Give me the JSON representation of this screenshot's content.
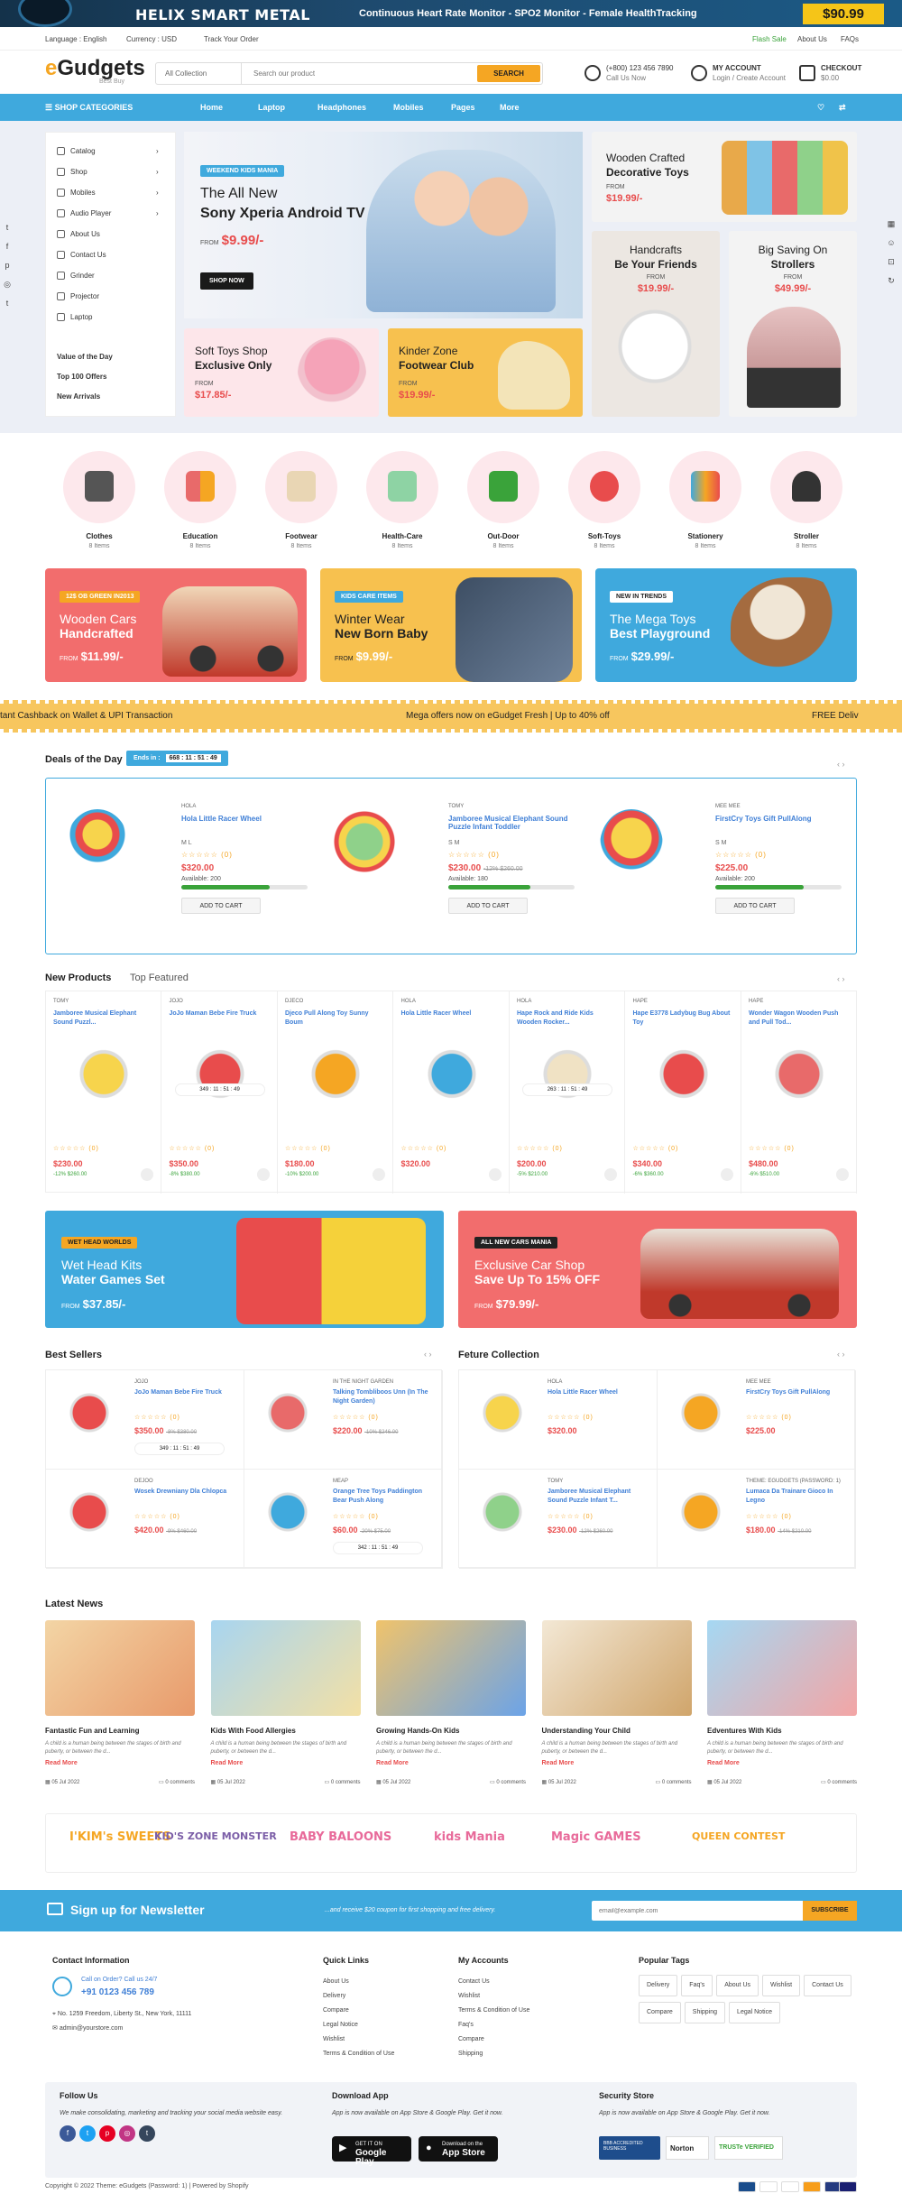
{
  "topbanner": {
    "brand": "HELIX SMART METAL",
    "promo": "Continuous Heart Rate Monitor - SPO2 Monitor - Female HealthTracking",
    "price": "$90.99"
  },
  "util": {
    "language": "Language : English",
    "currency": "Currency : USD",
    "track": "Track Your Order",
    "flash": "Flash Sale",
    "about": "About Us",
    "faqs": "FAQs"
  },
  "header": {
    "logo_e": "e",
    "logo_rest": "Gudgets",
    "logo_sub": "Best Buy",
    "search_cat": "All Collection",
    "search_placeholder": "Search our product",
    "search_btn": "SEARCH",
    "phone": "(+800) 123 456 7890",
    "phone_sub": "Call Us Now",
    "account": "MY ACCOUNT",
    "account_sub": "Login / Create Account",
    "checkout": "CHECKOUT",
    "checkout_sub": "$0.00"
  },
  "nav": {
    "categories": "SHOP CATEGORIES",
    "items": [
      "Home",
      "Laptop",
      "Headphones",
      "Mobiles",
      "Pages",
      "More"
    ]
  },
  "sidebar": {
    "items": [
      "Catalog",
      "Shop",
      "Mobiles",
      "Audio Player",
      "About Us",
      "Contact Us",
      "Grinder",
      "Projector",
      "Laptop"
    ],
    "links": [
      "Value of the Day",
      "Top 100 Offers",
      "New Arrivals"
    ]
  },
  "hero": {
    "tag": "WEEKEND KIDS MANIA",
    "t1": "The All New",
    "t2": "Sony Xperia Android TV",
    "from": "FROM",
    "price": "$9.99/-",
    "btn": "SHOP NOW"
  },
  "promo_small": [
    {
      "t1": "Soft Toys Shop",
      "t2": "Exclusive Only",
      "from": "FROM",
      "price": "$17.85/-"
    },
    {
      "t1": "Kinder Zone",
      "t2": "Footwear Club",
      "from": "FROM",
      "price": "$19.99/-"
    }
  ],
  "promo_right": [
    {
      "t1": "Wooden Crafted",
      "t2": "Decorative Toys",
      "from": "FROM",
      "price": "$19.99/-"
    },
    {
      "t1": "Handcrafts",
      "t2": "Be Your Friends",
      "from": "FROM",
      "price": "$19.99/-"
    },
    {
      "t1": "Big Saving On",
      "t2": "Strollers",
      "from": "FROM",
      "price": "$49.99/-"
    }
  ],
  "categories": [
    {
      "name": "Clothes",
      "count": "8 Items"
    },
    {
      "name": "Education",
      "count": "8 Items"
    },
    {
      "name": "Footwear",
      "count": "8 Items"
    },
    {
      "name": "Health-Care",
      "count": "8 Items"
    },
    {
      "name": "Out-Door",
      "count": "8 Items"
    },
    {
      "name": "Soft-Toys",
      "count": "8 Items"
    },
    {
      "name": "Stationery",
      "count": "8 Items"
    },
    {
      "name": "Stroller",
      "count": "8 Items"
    }
  ],
  "banners3": [
    {
      "tag": "12$ OB GREEN IN2013",
      "t1": "Wooden Cars",
      "t2": "Handcrafted",
      "from": "FROM",
      "price": "$11.99/-"
    },
    {
      "tag": "KIDS CARE ITEMS",
      "t1": "Winter Wear",
      "t2": "New Born Baby",
      "from": "FROM",
      "price": "$9.99/-"
    },
    {
      "tag": "NEW IN TRENDS",
      "t1": "The Mega Toys",
      "t2": "Best Playground",
      "from": "FROM",
      "price": "$29.99/-"
    }
  ],
  "ticker": {
    "a": "tant Cashback on Wallet & UPI Transaction",
    "b": "Mega offers now on eGudget Fresh | Up to 40% off",
    "c": "FREE Deliv"
  },
  "deals": {
    "title": "Deals of the Day",
    "ends": "Ends in :",
    "timer": "668 : 11 : 51 : 49",
    "items": [
      {
        "brand": "HOLA",
        "name": "Hola Little Racer Wheel",
        "swatch": "M L",
        "reviews": "(0)",
        "price": "$320.00",
        "old": "",
        "available": "Available: 200",
        "fill": 0.7,
        "cart": "ADD TO CART"
      },
      {
        "brand": "TOMY",
        "name": "Jamboree Musical Elephant Sound Puzzle Infant Toddler",
        "swatch": "S M",
        "reviews": "(0)",
        "price": "$230.00",
        "old": "-12% $260.00",
        "available": "Available: 180",
        "fill": 0.65,
        "cart": "ADD TO CART"
      },
      {
        "brand": "MEE MEE",
        "name": "FirstCry Toys Gift PullAlong",
        "swatch": "S M",
        "reviews": "(0)",
        "price": "$225.00",
        "old": "",
        "available": "Available: 200",
        "fill": 0.7,
        "cart": "ADD TO CART"
      }
    ]
  },
  "tabs": {
    "a": "New Products",
    "b": "Top Featured"
  },
  "products": [
    {
      "brand": "TOMY",
      "name": "Jamboree Musical Elephant Sound Puzzl...",
      "reviews": "(0)",
      "price": "$230.00",
      "disc": "-12% $260.00",
      "timer": ""
    },
    {
      "brand": "JOJO",
      "name": "JoJo Maman Bebe Fire Truck",
      "reviews": "(0)",
      "price": "$350.00",
      "disc": "-8% $380.00",
      "timer": "349 : 11 : 51 : 49"
    },
    {
      "brand": "DJECO",
      "name": "Djeco Pull Along Toy Sunny Boum",
      "reviews": "(0)",
      "price": "$180.00",
      "disc": "-10% $200.00",
      "timer": ""
    },
    {
      "brand": "HOLA",
      "name": "Hola Little Racer Wheel",
      "reviews": "(0)",
      "price": "$320.00",
      "disc": "",
      "timer": ""
    },
    {
      "brand": "HOLA",
      "name": "Hape Rock and Ride Kids Wooden Rocker...",
      "reviews": "(0)",
      "price": "$200.00",
      "disc": "-5% $210.00",
      "timer": "263 : 11 : 51 : 49"
    },
    {
      "brand": "HAPE",
      "name": "Hape E3778 Ladybug Bug About Toy",
      "reviews": "(0)",
      "price": "$340.00",
      "disc": "-6% $360.00",
      "timer": ""
    },
    {
      "brand": "HAPE",
      "name": "Wonder Wagon Wooden Push and Pull Tod...",
      "reviews": "(0)",
      "price": "$480.00",
      "disc": "-6% $510.00",
      "timer": ""
    }
  ],
  "bigbanners": [
    {
      "tag": "WET HEAD WORLDS",
      "t1": "Wet Head Kits",
      "t2": "Water Games Set",
      "from": "FROM",
      "price": "$37.85/-"
    },
    {
      "tag": "ALL NEW CARS MANIA",
      "t1": "Exclusive Car Shop",
      "t2": "Save Up To 15% OFF",
      "from": "FROM",
      "price": "$79.99/-"
    }
  ],
  "bestsellers": {
    "title": "Best Sellers",
    "items": [
      {
        "brand": "JOJO",
        "name": "JoJo Maman Bebe Fire Truck",
        "reviews": "(0)",
        "price": "$350.00",
        "old": "-8% $380.00",
        "timer": "349 : 11 : 51 : 49"
      },
      {
        "brand": "IN THE NIGHT GARDEN",
        "name": "Talking Tombliboos Unn (In The Night Garden)",
        "reviews": "(0)",
        "price": "$220.00",
        "old": "-10% $246.00",
        "timer": ""
      },
      {
        "brand": "DEJOO",
        "name": "Wosek Drewniany Dla Chlopca",
        "reviews": "(0)",
        "price": "$420.00",
        "old": "-9% $460.00",
        "timer": ""
      },
      {
        "brand": "MEAP",
        "name": "Orange Tree Toys Paddington Bear Push Along",
        "reviews": "(0)",
        "price": "$60.00",
        "old": "-20% $75.00",
        "timer": "342 : 11 : 51 : 49"
      }
    ]
  },
  "featured": {
    "title": "Feture Collection",
    "items": [
      {
        "brand": "HOLA",
        "name": "Hola Little Racer Wheel",
        "reviews": "(0)",
        "price": "$320.00",
        "old": ""
      },
      {
        "brand": "MEE MEE",
        "name": "FirstCry Toys Gift PullAlong",
        "reviews": "(0)",
        "price": "$225.00",
        "old": ""
      },
      {
        "brand": "TOMY",
        "name": "Jamboree Musical Elephant Sound Puzzle Infant T...",
        "reviews": "(0)",
        "price": "$230.00",
        "old": "-12% $260.00"
      },
      {
        "brand": "THEME: EGUDGETS (PASSWORD: 1)",
        "name": "Lumaca Da Trainare Gioco In Legno",
        "reviews": "(0)",
        "price": "$180.00",
        "old": "-14% $210.00"
      }
    ]
  },
  "news": {
    "title": "Latest News",
    "items": [
      {
        "t": "Fantastic Fun and Learning",
        "d": "A child is a human being between the stages of birth and puberty, or between the d...",
        "rm": "Read More",
        "date": "05 Jul 2022",
        "comments": "0 comments"
      },
      {
        "t": "Kids With Food Allergies",
        "d": "A child is a human being between the stages of birth and puberty, or between the d...",
        "rm": "Read More",
        "date": "05 Jul 2022",
        "comments": "0 comments"
      },
      {
        "t": "Growing Hands-On Kids",
        "d": "A child is a human being between the stages of birth and puberty, or between the d...",
        "rm": "Read More",
        "date": "05 Jul 2022",
        "comments": "0 comments"
      },
      {
        "t": "Understanding Your Child",
        "d": "A child is a human being between the stages of birth and puberty, or between the d...",
        "rm": "Read More",
        "date": "05 Jul 2022",
        "comments": "0 comments"
      },
      {
        "t": "Edventures With Kids",
        "d": "A child is a human being between the stages of birth and puberty, or between the d...",
        "rm": "Read More",
        "date": "05 Jul 2022",
        "comments": "0 comments"
      }
    ]
  },
  "brands": [
    "I'KIM's SWEETS",
    "KID'S ZONE MONSTER",
    "BABY BALOONS",
    "kids Mania",
    "Magic GAMES",
    "QUEEN CONTEST"
  ],
  "newsletter": {
    "title": "Sign up for Newsletter",
    "sub": "...and receive $20 coupon for first shopping and free delivery.",
    "placeholder": "email@example.com",
    "btn": "SUBSCRIBE"
  },
  "footer": {
    "contact": {
      "title": "Contact Information",
      "call": "Call on Order? Call us 24/7",
      "phone": "+91 0123 456 789",
      "address": "No. 1259 Freedom, Liberty St., New York, 11111",
      "email": "admin@yourstore.com"
    },
    "quick": {
      "title": "Quick Links",
      "items": [
        "About Us",
        "Delivery",
        "Compare",
        "Legal Notice",
        "Wishlist",
        "Terms & Condition of Use"
      ]
    },
    "account": {
      "title": "My Accounts",
      "items": [
        "Contact Us",
        "Wishlist",
        "Terms & Condition of Use",
        "Faq's",
        "Compare",
        "Shipping"
      ]
    },
    "tags": {
      "title": "Popular Tags",
      "items": [
        "Delivery",
        "Faq's",
        "About Us",
        "Wishlist",
        "Contact Us",
        "Compare",
        "Shipping",
        "Legal Notice"
      ]
    },
    "follow": {
      "title": "Follow Us",
      "text": "We make consolidating, marketing and tracking your social media website easy."
    },
    "app": {
      "title": "Download App",
      "text": "App is now available on App Store & Google Play. Get it now.",
      "gp_small": "GET IT ON",
      "gp": "Google Play",
      "as_small": "Download on the",
      "as": "App Store"
    },
    "security": {
      "title": "Security Store",
      "text": "App is now available on App Store & Google Play. Get it now.",
      "badges": [
        "BBB ACCREDITED BUSINESS",
        "Norton",
        "TRUSTe VERIFIED"
      ]
    },
    "copyright": "Copyright © 2022 Theme: eGudgets (Password: 1) | Powered by Shopify"
  }
}
